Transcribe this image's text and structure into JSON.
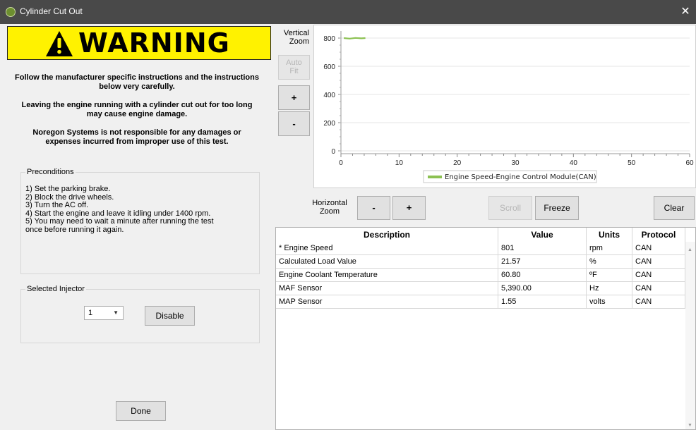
{
  "window": {
    "title": "Cylinder Cut Out",
    "close_glyph": "✕"
  },
  "warning": {
    "banner": "WARNING",
    "icon": "warning-triangle-icon",
    "line1a": "Follow the manufacturer specific instructions and the instructions",
    "line1b": "below very carefully.",
    "line2a": "Leaving the engine running with a cylinder cut out for too long",
    "line2b": "may cause engine damage.",
    "line3a": "Noregon Systems is not responsible for any damages or",
    "line3b": "expenses incurred from improper use of this test."
  },
  "preconditions": {
    "label": "Preconditions",
    "items": [
      "1) Set the parking brake.",
      "2) Block the drive wheels.",
      "3) Turn the AC off.",
      "4) Start the engine and leave it idling under 1400 rpm.",
      "5) You may need to wait a minute after running the test",
      "once before running it again."
    ]
  },
  "injector": {
    "label": "Selected Injector",
    "selected": "1",
    "disable_label": "Disable"
  },
  "done_label": "Done",
  "vertical_zoom": {
    "line1": "Vertical",
    "line2": "Zoom",
    "autofit_line1": "Auto",
    "autofit_line2": "Fit",
    "plus": "+",
    "minus": "-"
  },
  "horizontal_zoom": {
    "line1": "Horizontal",
    "line2": "Zoom",
    "minus": "-",
    "plus": "+"
  },
  "controls": {
    "scroll": "Scroll",
    "freeze": "Freeze",
    "clear": "Clear"
  },
  "chart_data": {
    "type": "line",
    "series": [
      {
        "name": "Engine Speed-Engine Control Module(CAN)",
        "color": "#8cc152",
        "points": [
          [
            0.5,
            800
          ],
          [
            1.5,
            796
          ],
          [
            2.5,
            801
          ],
          [
            3.5,
            798
          ],
          [
            4.2,
            800
          ]
        ]
      }
    ],
    "xlim": [
      0,
      60
    ],
    "ylim": [
      -20,
      850
    ],
    "x_ticks": [
      "0",
      "10",
      "20",
      "30",
      "40",
      "50",
      "60"
    ],
    "y_ticks": [
      "0",
      "200",
      "400",
      "600",
      "800"
    ],
    "legend_position": "bottom-center",
    "grid": "horizontal"
  },
  "table": {
    "headers": [
      "Description",
      "Value",
      "Units",
      "Protocol"
    ],
    "rows": [
      [
        "* Engine Speed",
        "801",
        "rpm",
        "CAN"
      ],
      [
        "Calculated Load Value",
        "21.57",
        "%",
        "CAN"
      ],
      [
        "Engine Coolant Temperature",
        "60.80",
        "ºF",
        "CAN"
      ],
      [
        "MAF Sensor",
        "5,390.00",
        "Hz",
        "CAN"
      ],
      [
        "MAP Sensor",
        "1.55",
        "volts",
        "CAN"
      ]
    ]
  }
}
